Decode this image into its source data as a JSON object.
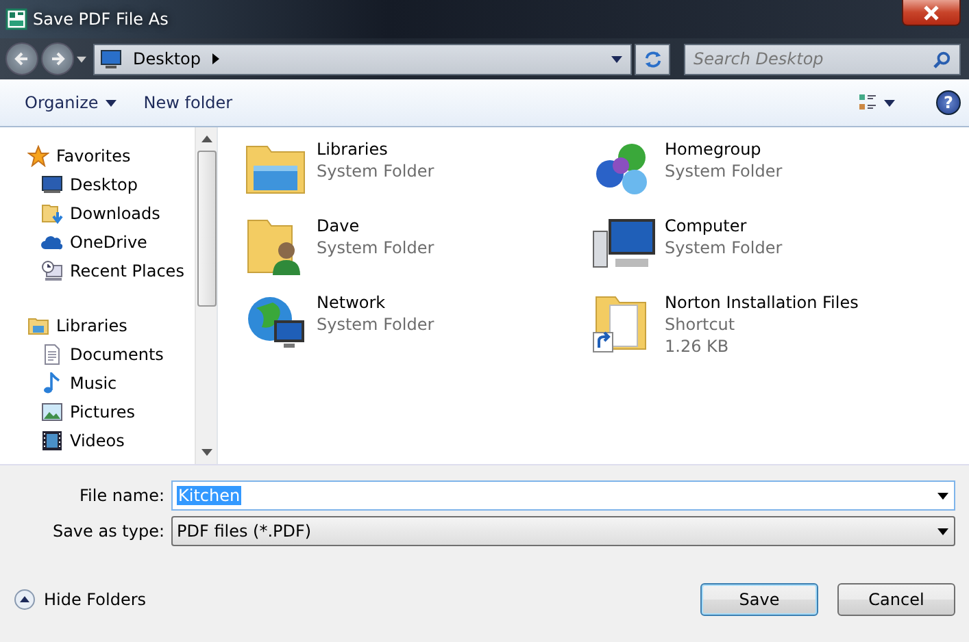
{
  "window": {
    "title": "Save PDF File As"
  },
  "address": {
    "path": "Desktop",
    "search_placeholder": "Search Desktop"
  },
  "toolbar": {
    "organize": "Organize",
    "new_folder": "New folder",
    "help": "?"
  },
  "sidebar": {
    "groups": [
      {
        "label": "Favorites",
        "kind": "star",
        "children": [
          {
            "label": "Desktop",
            "kind": "desktop"
          },
          {
            "label": "Downloads",
            "kind": "downloads"
          },
          {
            "label": "OneDrive",
            "kind": "cloud"
          },
          {
            "label": "Recent Places",
            "kind": "recent"
          }
        ]
      },
      {
        "label": "Libraries",
        "kind": "libraries",
        "children": [
          {
            "label": "Documents",
            "kind": "document"
          },
          {
            "label": "Music",
            "kind": "music"
          },
          {
            "label": "Pictures",
            "kind": "pictures"
          },
          {
            "label": "Videos",
            "kind": "videos"
          }
        ]
      }
    ]
  },
  "files": [
    {
      "name": "Libraries",
      "type": "System Folder",
      "kind": "libraries"
    },
    {
      "name": "Homegroup",
      "type": "System Folder",
      "kind": "homegroup"
    },
    {
      "name": "Dave",
      "type": "System Folder",
      "kind": "user"
    },
    {
      "name": "Computer",
      "type": "System Folder",
      "kind": "computer"
    },
    {
      "name": "Network",
      "type": "System Folder",
      "kind": "network"
    },
    {
      "name": "Norton Installation Files",
      "type": "Shortcut",
      "size": "1.26 KB",
      "kind": "shortcut"
    }
  ],
  "form": {
    "file_name_label": "File name:",
    "file_name": "Kitchen",
    "type_label": "Save as type:",
    "type": "PDF files (*.PDF)"
  },
  "hide_folders": "Hide Folders",
  "buttons": [
    {
      "label": "Save",
      "kind": "default"
    },
    {
      "label": "Cancel",
      "kind": "normal"
    }
  ]
}
